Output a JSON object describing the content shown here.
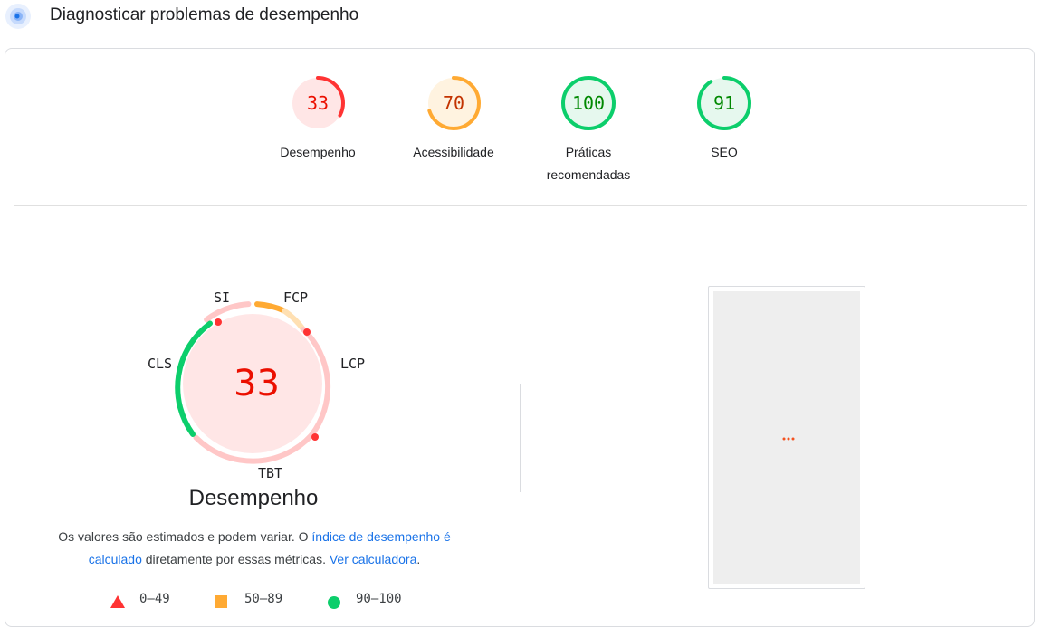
{
  "header": {
    "title": "Diagnosticar problemas de desempenho",
    "icon": "lighthouse-icon"
  },
  "categories": [
    {
      "name": "Desempenho",
      "score": "33",
      "value": 33,
      "rating": "fail"
    },
    {
      "name": "Acessibilidade",
      "score": "70",
      "value": 70,
      "rating": "average"
    },
    {
      "name": "Práticas recomendadas",
      "score": "100",
      "value": 100,
      "rating": "pass"
    },
    {
      "name": "SEO",
      "score": "91",
      "value": 91,
      "rating": "pass"
    }
  ],
  "performance": {
    "score": "33",
    "title": "Desempenho",
    "metrics": {
      "si": "SI",
      "fcp": "FCP",
      "lcp": "LCP",
      "tbt": "TBT",
      "cls": "CLS"
    },
    "note": {
      "text1": "Os valores são estimados e podem variar. O ",
      "link1": "índice de desempenho é calculado",
      "text2": " diretamente por essas métricas. ",
      "link2": "Ver calculadora",
      "text3": "."
    }
  },
  "legend": [
    {
      "shape": "triangle",
      "range": "0–49",
      "color": "#ff3333"
    },
    {
      "shape": "square",
      "range": "50–89",
      "color": "#ffaa33"
    },
    {
      "shape": "circle",
      "range": "90–100",
      "color": "#0cce6b"
    }
  ],
  "colors": {
    "fail": "#eb0f00",
    "fail_ring": "#ff3333",
    "fail_bg": "#ffe6e6",
    "average": "#c33300",
    "average_ring": "#ffaa33",
    "average_bg": "#fff3e0",
    "pass": "#008800",
    "pass_ring": "#0cce6b",
    "pass_bg": "#e6f8ee",
    "link": "#1a73e8"
  }
}
